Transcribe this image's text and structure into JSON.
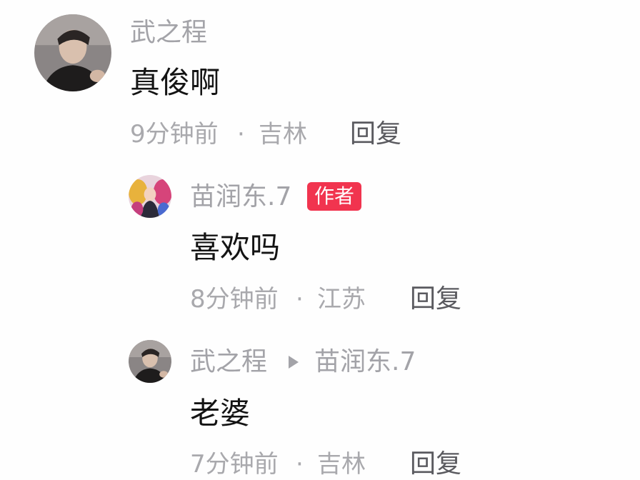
{
  "comments": [
    {
      "username": "武之程",
      "text": "真俊啊",
      "time": "9分钟前",
      "location": "吉林",
      "reply_label": "回复"
    },
    {
      "username": "苗润东.7",
      "badge": "作者",
      "text": "喜欢吗",
      "time": "8分钟前",
      "location": "江苏",
      "reply_label": "回复"
    },
    {
      "username": "武之程",
      "reply_to": "苗润东.7",
      "text": "老婆",
      "time": "7分钟前",
      "location": "吉林",
      "reply_label": "回复"
    }
  ],
  "separator": "·"
}
